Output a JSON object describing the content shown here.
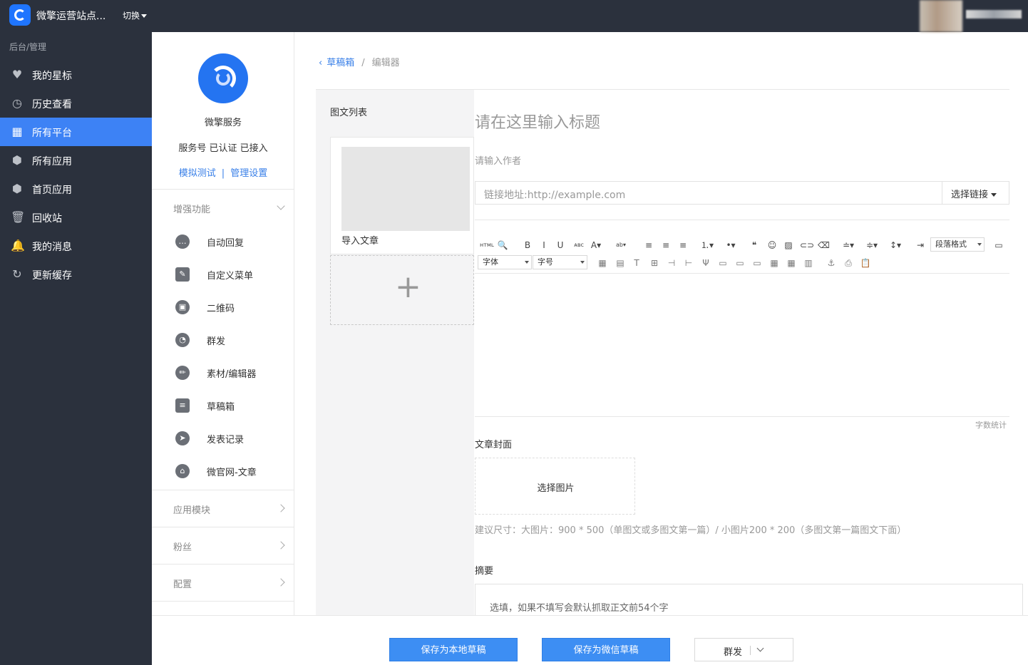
{
  "topbar": {
    "site_name": "微擎运营站点...",
    "switch_label": "切换"
  },
  "leftnav": {
    "heading": "后台/管理",
    "items": [
      {
        "label": "我的星标",
        "icon": "heart-icon",
        "glyph": "♥"
      },
      {
        "label": "历史查看",
        "icon": "clock-icon",
        "glyph": "◷"
      },
      {
        "label": "所有平台",
        "icon": "grid-icon",
        "glyph": "▦",
        "active": true
      },
      {
        "label": "所有应用",
        "icon": "cube-icon",
        "glyph": "⬢"
      },
      {
        "label": "首页应用",
        "icon": "cube-icon",
        "glyph": "⬢"
      },
      {
        "label": "回收站",
        "icon": "trash-icon",
        "glyph": "🗑"
      },
      {
        "label": "我的消息",
        "icon": "bell-icon",
        "glyph": "🔔"
      },
      {
        "label": "更新缓存",
        "icon": "refresh-icon",
        "glyph": "↻"
      }
    ]
  },
  "account": {
    "name": "微擎服务",
    "meta": "服务号 已认证 已接入",
    "link_test": "模拟测试",
    "link_sep": "|",
    "link_manage": "管理设置"
  },
  "sections": {
    "enhanced": "增强功能",
    "modules": "应用模块",
    "fans": "粉丝",
    "config": "配置"
  },
  "functions": [
    {
      "label": "自动回复",
      "icon": "chat-icon",
      "glyph": "…"
    },
    {
      "label": "自定义菜单",
      "icon": "edit-doc-icon",
      "glyph": "✎"
    },
    {
      "label": "二维码",
      "icon": "qrcode-icon",
      "glyph": "▣"
    },
    {
      "label": "群发",
      "icon": "broadcast-icon",
      "glyph": "◔"
    },
    {
      "label": "素材/编辑器",
      "icon": "pencil-icon",
      "glyph": "✏"
    },
    {
      "label": "草稿箱",
      "icon": "draft-icon",
      "glyph": "≡"
    },
    {
      "label": "发表记录",
      "icon": "send-icon",
      "glyph": "➤"
    },
    {
      "label": "微官网-文章",
      "icon": "home-icon",
      "glyph": "⌂"
    }
  ],
  "breadcrumb": {
    "back": "‹",
    "parent": "草稿箱",
    "sep": "/",
    "current": "编辑器"
  },
  "article_list": {
    "title": "图文列表",
    "item_title": "导入文章",
    "add": "+"
  },
  "editor": {
    "title_placeholder": "请在这里输入标题",
    "author_placeholder": "请输入作者",
    "url_placeholder": "链接地址:http://example.com",
    "link_select": "选择链接",
    "paragraph_format": "段落格式",
    "font_family": "字体",
    "font_size": "字号",
    "word_count": "字数统计",
    "toolbar_row1": [
      {
        "icon": "html-icon",
        "g": "ʜᴛᴍʟ"
      },
      {
        "icon": "search-icon",
        "g": "🔍"
      },
      {
        "icon": "bold-icon",
        "g": "B"
      },
      {
        "icon": "italic-icon",
        "g": "I"
      },
      {
        "icon": "underline-icon",
        "g": "U"
      },
      {
        "icon": "strikethrough-icon",
        "g": "ᴀʙᴄ"
      },
      {
        "icon": "font-color-icon",
        "g": "A▾"
      },
      {
        "icon": "highlight-icon",
        "g": "ab▾"
      },
      {
        "icon": "align-left-icon",
        "g": "≡"
      },
      {
        "icon": "align-center-icon",
        "g": "≡"
      },
      {
        "icon": "align-right-icon",
        "g": "≡"
      },
      {
        "icon": "ordered-list-icon",
        "g": "⒈▾"
      },
      {
        "icon": "unordered-list-icon",
        "g": "•▾"
      },
      {
        "icon": "quote-icon",
        "g": "❝"
      },
      {
        "icon": "emoji-icon",
        "g": "☺"
      },
      {
        "icon": "image-icon",
        "g": "▨"
      },
      {
        "icon": "link-icon",
        "g": "⊂⊃"
      },
      {
        "icon": "eraser-icon",
        "g": "⌫"
      },
      {
        "icon": "row-spacing-top-icon",
        "g": "≐▾"
      },
      {
        "icon": "row-spacing-bottom-icon",
        "g": "≑▾"
      },
      {
        "icon": "line-height-icon",
        "g": "↕▾"
      },
      {
        "icon": "indent-icon",
        "g": "⇥"
      }
    ],
    "toolbar_row2": [
      {
        "icon": "table-icon",
        "g": "▦"
      },
      {
        "icon": "table-props-icon",
        "g": "▤"
      },
      {
        "icon": "caption-icon",
        "g": "T"
      },
      {
        "icon": "insert-row-icon",
        "g": "⊞"
      },
      {
        "icon": "insert-col-left-icon",
        "g": "⊣"
      },
      {
        "icon": "insert-col-right-icon",
        "g": "⊢"
      },
      {
        "icon": "split-icon",
        "g": "Ψ"
      },
      {
        "icon": "merge-icon",
        "g": "▭"
      },
      {
        "icon": "merge-right-icon",
        "g": "▭"
      },
      {
        "icon": "merge-down-icon",
        "g": "▭"
      },
      {
        "icon": "delete-row-icon",
        "g": "▦"
      },
      {
        "icon": "delete-col-icon",
        "g": "▦"
      },
      {
        "icon": "delete-table-icon",
        "g": "▥"
      },
      {
        "icon": "anchor-icon",
        "g": "⚓"
      },
      {
        "icon": "print-icon",
        "g": "⎙"
      },
      {
        "icon": "paste-icon",
        "g": "📋"
      }
    ],
    "cover_title": "文章封面",
    "cover_select": "选择图片",
    "cover_hint": "建议尺寸：大图片：900 * 500（单图文或多图文第一篇）/ 小图片200 * 200（多图文第一篇图文下面）",
    "abstract_title": "摘要",
    "abstract_placeholder": "选填，如果不填写会默认抓取正文前54个字"
  },
  "footer": {
    "save_local": "保存为本地草稿",
    "save_wechat": "保存为微信草稿",
    "broadcast": "群发"
  }
}
